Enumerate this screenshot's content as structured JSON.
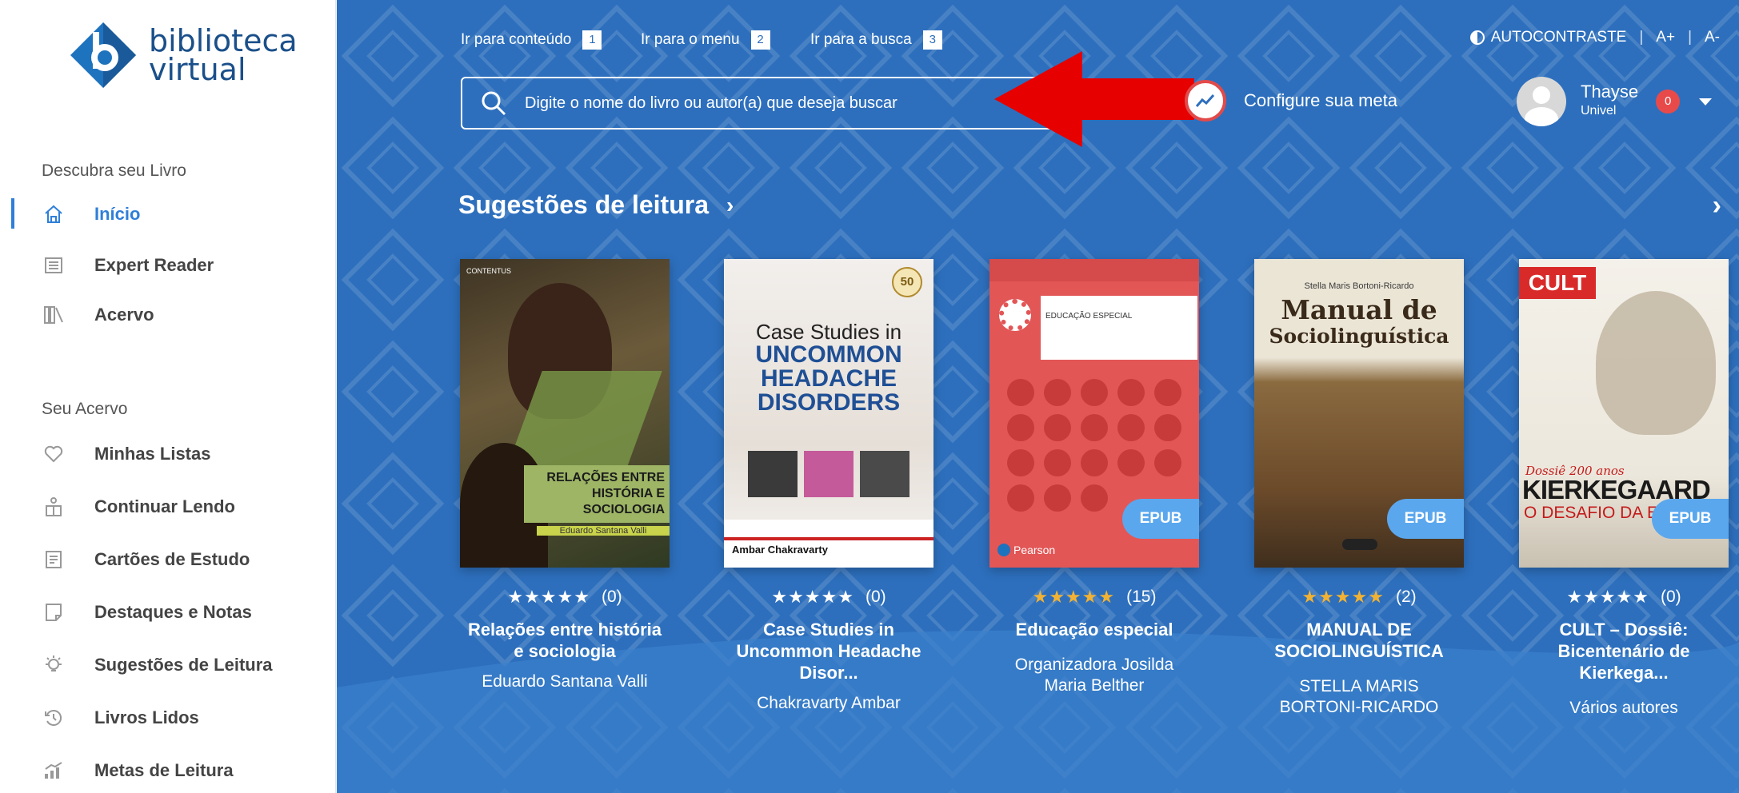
{
  "sidebar": {
    "logo_line1": "biblioteca",
    "logo_line2": "virtual",
    "section1": "Descubra seu Livro",
    "section2": "Seu Acervo",
    "items_top": [
      {
        "label": "Início",
        "icon": "home-icon"
      },
      {
        "label": "Expert Reader",
        "icon": "expert-reader-icon"
      },
      {
        "label": "Acervo",
        "icon": "bookshelf-icon"
      }
    ],
    "items_bottom": [
      {
        "label": "Minhas Listas",
        "icon": "heart-icon"
      },
      {
        "label": "Continuar Lendo",
        "icon": "reading-person-icon"
      },
      {
        "label": "Cartões de Estudo",
        "icon": "flashcard-icon"
      },
      {
        "label": "Destaques e Notas",
        "icon": "note-icon"
      },
      {
        "label": "Sugestões de Leitura",
        "icon": "lightbulb-icon"
      },
      {
        "label": "Livros Lidos",
        "icon": "history-icon"
      },
      {
        "label": "Metas de Leitura",
        "icon": "goal-chart-icon"
      }
    ]
  },
  "topbar": {
    "skip": [
      {
        "label": "Ir para conteúdo",
        "num": "1"
      },
      {
        "label": "Ir para o menu",
        "num": "2"
      },
      {
        "label": "Ir para a busca",
        "num": "3"
      }
    ],
    "contrast": "AUTOCONTRASTE",
    "font_up": "A+",
    "font_down": "A-",
    "search_placeholder": "Digite o nome do livro ou autor(a) que deseja buscar",
    "goal": "Configure sua meta",
    "user_name": "Thayse",
    "user_org": "Univel",
    "notif_count": "0"
  },
  "section": {
    "title": "Sugestões de leitura",
    "chevron": "›",
    "next": "›"
  },
  "books": [
    {
      "title": "Relações entre história e sociologia",
      "author": "Eduardo Santana Valli",
      "stars": "★★★★★",
      "reviews": "(0)",
      "epub": false
    },
    {
      "title": "Case Studies in Uncommon Headache Disor...",
      "author": "Chakravarty Ambar",
      "stars": "★★★★★",
      "reviews": "(0)",
      "epub": false
    },
    {
      "title": "Educação especial",
      "author": "Organizadora Josilda Maria Belther",
      "stars": "★★★★★",
      "reviews": "(15)",
      "epub": true,
      "epub_label": "EPUB"
    },
    {
      "title": "MANUAL DE SOCIOLINGUÍSTICA",
      "author": "STELLA MARIS BORTONI-RICARDO",
      "stars": "★★★★★",
      "reviews": "(2)",
      "epub": true,
      "epub_label": "EPUB"
    },
    {
      "title": "CULT – Dossiê: Bicentenário de Kierkega...",
      "author": "Vários autores",
      "stars": "★★★★★",
      "reviews": "(0)",
      "epub": true,
      "epub_label": "EPUB"
    }
  ],
  "covers": {
    "book1": {
      "brand": "CONTENTUS",
      "title": "RELAÇÕES ENTRE HISTÓRIA E SOCIOLOGIA",
      "author": "Eduardo Santana Valli"
    },
    "book2": {
      "l1": "Case Studies in",
      "l2": "UNCOMMON",
      "l3": "HEADACHE",
      "l4": "DISORDERS",
      "author": "Ambar Chakravarty",
      "badge": "50"
    },
    "book3": {
      "title": "EDUCAÇÃO ESPECIAL",
      "brand": "Pearson"
    },
    "book4": {
      "author": "Stella Maris Bortoni-Ricardo",
      "l1": "Manual de",
      "l2": "Sociolinguística"
    },
    "book5": {
      "brand": "CULT",
      "sub": "Dossiê 200 anos",
      "name": "KIERKEGAARD",
      "desc": "O DESAFIO DA E"
    }
  },
  "colors": {
    "main_bg": "#2d6fbd",
    "accent": "#2f7fd8",
    "arrow": "#e60000",
    "epub": "#5aa7ee"
  }
}
